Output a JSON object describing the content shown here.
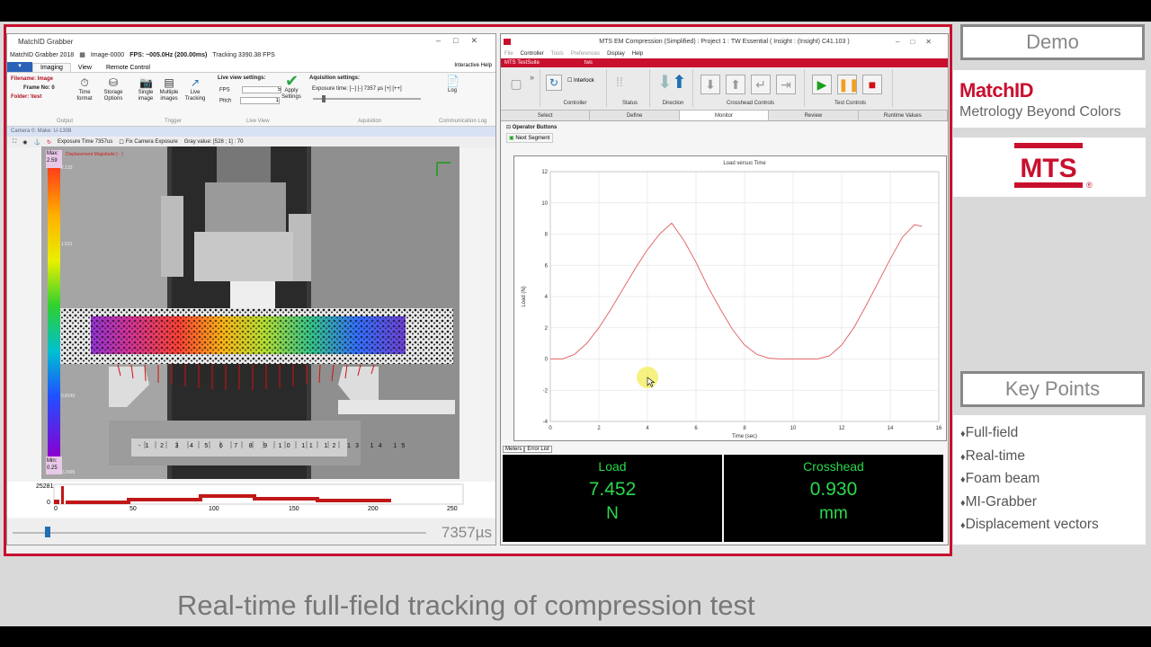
{
  "left_app": {
    "title": "MatchID Grabber",
    "version": "MatchID Grabber 2018",
    "image_name": "Image-0000",
    "fps_readout": "FPS: ~005.0Hz (200.00ms)",
    "tracking": "Tracking 3390.38 FPS",
    "tabs": [
      "Imaging",
      "View",
      "Remote Control"
    ],
    "active_tab": "Imaging",
    "interactive_help": "Interactive Help",
    "filename_label": "Filename: Image",
    "frame_label": "Frame No: 0",
    "folder_label": "Folder: \\test",
    "buttons": {
      "time_format": "Time format",
      "storage_options": "Storage Options",
      "single_image": "Single image",
      "multiple_images": "Multiple images",
      "live_tracking": "Live Tracking",
      "apply_settings": "Apply Settings",
      "log": "Log"
    },
    "groups": {
      "output": "Output",
      "trigger": "Trigger",
      "live_view": "Live View",
      "aquisition": "Aquisition",
      "comm_log": "Communication Log"
    },
    "live_view_settings": "Live view settings:",
    "fps_label": "FPS",
    "fps_value": "5",
    "pitch_label": "Pitch",
    "pitch_value": "1",
    "aquisition_settings": "Aquisition settings:",
    "exposure_label": "Exposure time: [--] [-] 7357 µs [+] [++]",
    "camera_bar": "Camera 0: Make: U-1308",
    "exposure_tool": "Exposure Time 7357us",
    "fix_camera": "Fix Camera Exposure",
    "gray_value": "Gray value: [528 ; 1] : 70",
    "colorbar_max_label": "Max:",
    "colorbar_max": "2.59",
    "colorbar_min_label": "Min:",
    "colorbar_min": "0.25",
    "colorbar_title": "Displacement Magnitude [ - ]",
    "colorbar_ticks": [
      "2.133",
      "1.631",
      "0.8140",
      "0.2499"
    ],
    "hist_max": "25281",
    "hist_ticks": [
      "0",
      "50",
      "100",
      "150",
      "200",
      "250"
    ],
    "hist_zero": "0",
    "exposure_big": "7357µs"
  },
  "right_app": {
    "title": "MTS EM Compression (Simplified) : Project 1 : TW Essential ( Insight : (Insight) C41.103 )",
    "menu": [
      "File",
      "Controller",
      "Tools",
      "Preferences",
      "Display",
      "Help"
    ],
    "testsuite": "MTS TestSuite",
    "tws": "tws",
    "interlock": "Interlock",
    "toolbar_groups": {
      "controller": "Controller",
      "status": "Status",
      "direction": "Direction",
      "crosshead": "Crosshead Controls",
      "test_controls": "Test Controls"
    },
    "tabs": [
      "Select",
      "Define",
      "Monitor",
      "Review",
      "Runtime Values"
    ],
    "active_tab": "Monitor",
    "operator_buttons": "Operator Buttons",
    "next_segment": "Next Segment",
    "meter_tabs": [
      "Meters",
      "Error List"
    ],
    "meters": [
      {
        "title": "Load",
        "value": "7.452",
        "unit": "N"
      },
      {
        "title": "Crosshead",
        "value": "0.930",
        "unit": "mm"
      }
    ]
  },
  "chart_data": {
    "type": "line",
    "title": "Load versus Time",
    "xlabel": "Time (sec)",
    "ylabel": "Load (N)",
    "xlim": [
      0,
      16
    ],
    "ylim": [
      -4,
      12
    ],
    "xticks": [
      0,
      2,
      4,
      6,
      8,
      10,
      12,
      14,
      16
    ],
    "yticks": [
      -4,
      -2,
      0,
      2,
      4,
      6,
      8,
      10,
      12
    ],
    "grid": true,
    "color": "#e36b6b",
    "x": [
      0,
      0.5,
      1,
      1.5,
      2,
      2.5,
      3,
      3.5,
      4,
      4.5,
      5,
      5.5,
      6,
      6.5,
      7,
      7.5,
      8,
      8.5,
      9,
      9.5,
      10,
      10.5,
      11,
      11.5,
      12,
      12.5,
      13,
      13.5,
      14,
      14.5,
      15,
      15.3
    ],
    "y": [
      0,
      0,
      0.3,
      1.0,
      2.0,
      3.2,
      4.5,
      5.8,
      7.0,
      8.0,
      8.7,
      7.6,
      6.2,
      4.6,
      3.2,
      1.9,
      0.9,
      0.3,
      0.05,
      0,
      0,
      0,
      0,
      0.2,
      0.9,
      2.0,
      3.4,
      4.9,
      6.4,
      7.8,
      8.6,
      8.5
    ]
  },
  "side_panel": {
    "demo": "Demo",
    "brand_name": "MatchID",
    "brand_tagline": "Metrology Beyond Colors",
    "mts_logo": "MTS",
    "key_points_title": "Key Points",
    "key_points": [
      "Full-field",
      "Real-time",
      "Foam beam",
      "MI-Grabber",
      "Displacement vectors"
    ]
  },
  "caption": "Real-time full-field tracking of compression test",
  "colors": {
    "accent": "#c8102e",
    "meter_text": "#2bd94c"
  }
}
